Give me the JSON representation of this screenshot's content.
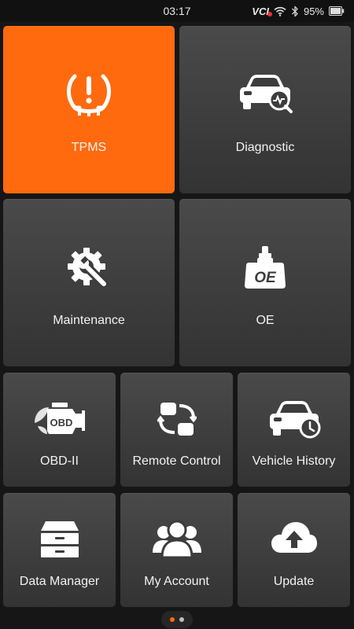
{
  "status_bar": {
    "time": "03:17",
    "vci_label": "VCI",
    "battery": "95%",
    "icons": [
      "vci-disconnected-icon",
      "wifi-icon",
      "bluetooth-icon",
      "battery-icon"
    ]
  },
  "tiles": {
    "tpms": {
      "label": "TPMS",
      "icon": "tire-pressure-warning-icon"
    },
    "diagnostic": {
      "label": "Diagnostic",
      "icon": "car-diagnostic-icon"
    },
    "maintenance": {
      "label": "Maintenance",
      "icon": "gear-wrench-icon"
    },
    "oe": {
      "label": "OE",
      "icon": "oe-sensor-icon",
      "icon_text": "OE"
    },
    "obd": {
      "label": "OBD-II",
      "icon": "engine-obd-icon",
      "icon_text": "OBD"
    },
    "remote": {
      "label": "Remote Control",
      "icon": "remote-control-icon"
    },
    "history": {
      "label": "Vehicle History",
      "icon": "car-history-icon"
    },
    "data_manager": {
      "label": "Data Manager",
      "icon": "cabinet-icon"
    },
    "account": {
      "label": "My Account",
      "icon": "users-icon"
    },
    "update": {
      "label": "Update",
      "icon": "cloud-upload-icon"
    }
  },
  "pager": {
    "pages": 2,
    "current": 1
  },
  "colors": {
    "accent": "#ff6a0f",
    "tile": "#3d3d3d",
    "background": "#161616"
  }
}
